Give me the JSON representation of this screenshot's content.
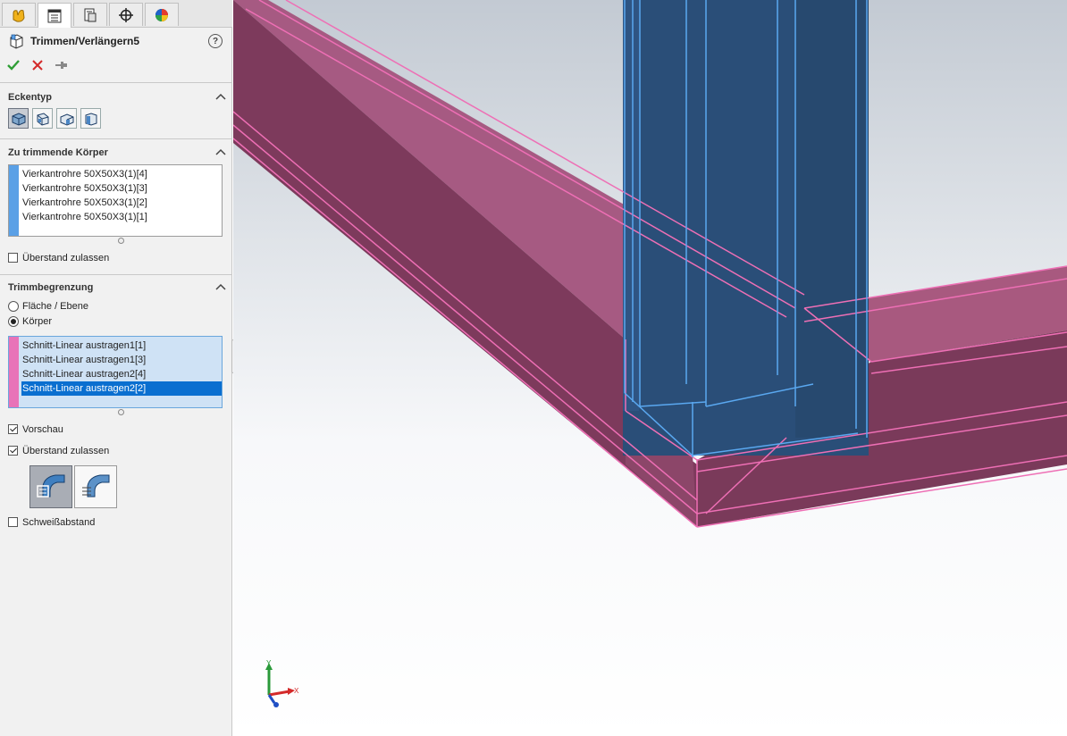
{
  "panel": {
    "tabs": [
      {
        "name": "featuremanager-tab-icon"
      },
      {
        "name": "propertymanager-tab-icon"
      },
      {
        "name": "configurationmanager-tab-icon"
      },
      {
        "name": "dimxpertmanager-tab-icon"
      },
      {
        "name": "displaymanager-tab-icon"
      }
    ],
    "feature_title": "Trimmen/Verlängern5",
    "help_glyph": "?",
    "sections": {
      "corner_type": {
        "title": "Eckentyp"
      },
      "bodies_to_trim": {
        "title": "Zu trimmende Körper",
        "items": [
          "Vierkantrohre 50X50X3(1)[4]",
          "Vierkantrohre 50X50X3(1)[3]",
          "Vierkantrohre 50X50X3(1)[2]",
          "Vierkantrohre 50X50X3(1)[1]"
        ],
        "allow_extension_label": "Überstand zulassen"
      },
      "trim_boundary": {
        "title": "Trimmbegrenzung",
        "option_face": "Fläche / Ebene",
        "option_body": "Körper",
        "items": [
          "Schnitt-Linear austragen1[1]",
          "Schnitt-Linear austragen1[3]",
          "Schnitt-Linear austragen2[4]",
          "Schnitt-Linear austragen2[2]"
        ],
        "selected_index": 3,
        "preview_label": "Vorschau",
        "allow_extension_label": "Überstand zulassen",
        "weld_gap_label": "Schweißabstand"
      }
    },
    "colors": {
      "blue_stripe": "#5aa0e6",
      "pink_stripe": "#e873b8",
      "selection": "#0a6fd0"
    }
  },
  "viewport": {
    "triad": {
      "x_label": "X",
      "y_label": "Y"
    }
  }
}
